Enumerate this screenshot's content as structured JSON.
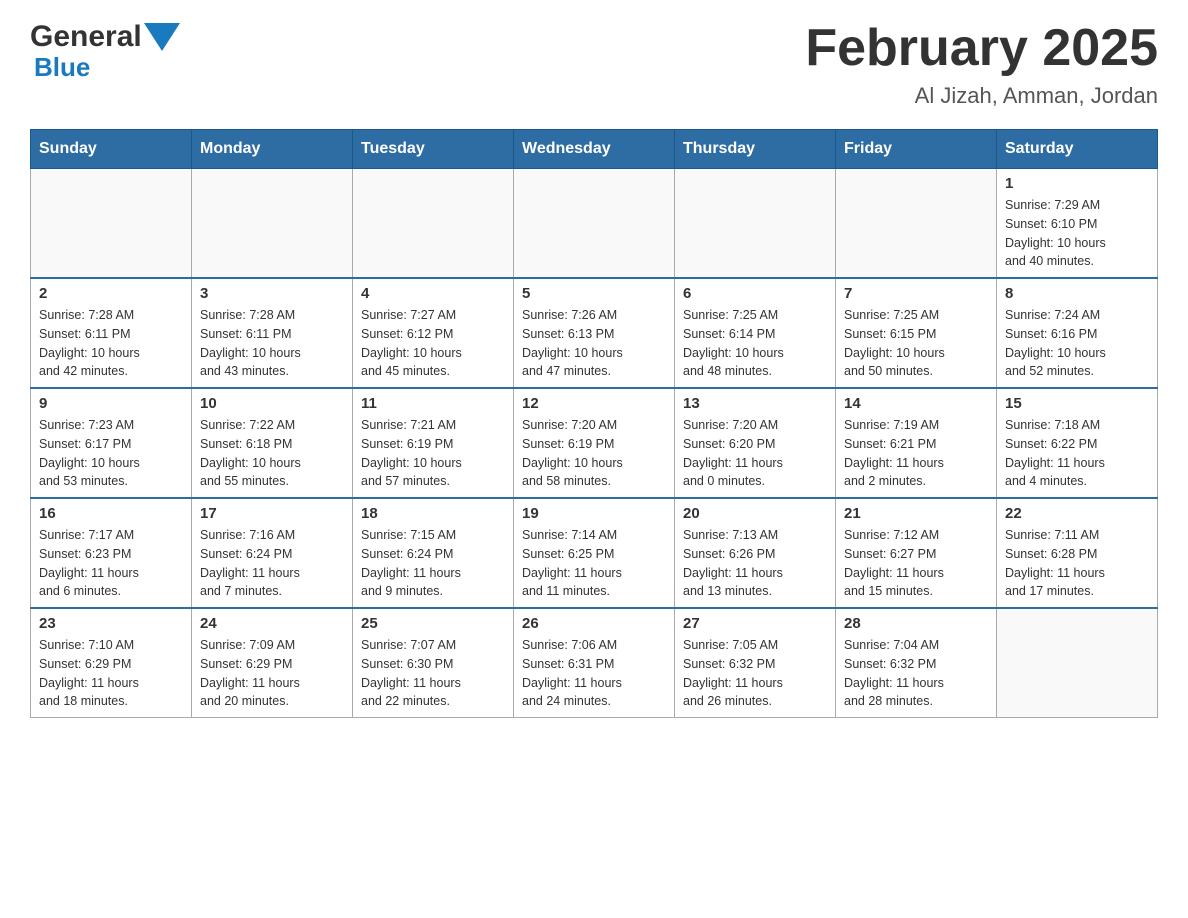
{
  "header": {
    "logo": {
      "general": "General",
      "blue": "Blue"
    },
    "title": "February 2025",
    "location": "Al Jizah, Amman, Jordan"
  },
  "days_of_week": [
    "Sunday",
    "Monday",
    "Tuesday",
    "Wednesday",
    "Thursday",
    "Friday",
    "Saturday"
  ],
  "weeks": [
    [
      {
        "day": "",
        "info": ""
      },
      {
        "day": "",
        "info": ""
      },
      {
        "day": "",
        "info": ""
      },
      {
        "day": "",
        "info": ""
      },
      {
        "day": "",
        "info": ""
      },
      {
        "day": "",
        "info": ""
      },
      {
        "day": "1",
        "info": "Sunrise: 7:29 AM\nSunset: 6:10 PM\nDaylight: 10 hours\nand 40 minutes."
      }
    ],
    [
      {
        "day": "2",
        "info": "Sunrise: 7:28 AM\nSunset: 6:11 PM\nDaylight: 10 hours\nand 42 minutes."
      },
      {
        "day": "3",
        "info": "Sunrise: 7:28 AM\nSunset: 6:11 PM\nDaylight: 10 hours\nand 43 minutes."
      },
      {
        "day": "4",
        "info": "Sunrise: 7:27 AM\nSunset: 6:12 PM\nDaylight: 10 hours\nand 45 minutes."
      },
      {
        "day": "5",
        "info": "Sunrise: 7:26 AM\nSunset: 6:13 PM\nDaylight: 10 hours\nand 47 minutes."
      },
      {
        "day": "6",
        "info": "Sunrise: 7:25 AM\nSunset: 6:14 PM\nDaylight: 10 hours\nand 48 minutes."
      },
      {
        "day": "7",
        "info": "Sunrise: 7:25 AM\nSunset: 6:15 PM\nDaylight: 10 hours\nand 50 minutes."
      },
      {
        "day": "8",
        "info": "Sunrise: 7:24 AM\nSunset: 6:16 PM\nDaylight: 10 hours\nand 52 minutes."
      }
    ],
    [
      {
        "day": "9",
        "info": "Sunrise: 7:23 AM\nSunset: 6:17 PM\nDaylight: 10 hours\nand 53 minutes."
      },
      {
        "day": "10",
        "info": "Sunrise: 7:22 AM\nSunset: 6:18 PM\nDaylight: 10 hours\nand 55 minutes."
      },
      {
        "day": "11",
        "info": "Sunrise: 7:21 AM\nSunset: 6:19 PM\nDaylight: 10 hours\nand 57 minutes."
      },
      {
        "day": "12",
        "info": "Sunrise: 7:20 AM\nSunset: 6:19 PM\nDaylight: 10 hours\nand 58 minutes."
      },
      {
        "day": "13",
        "info": "Sunrise: 7:20 AM\nSunset: 6:20 PM\nDaylight: 11 hours\nand 0 minutes."
      },
      {
        "day": "14",
        "info": "Sunrise: 7:19 AM\nSunset: 6:21 PM\nDaylight: 11 hours\nand 2 minutes."
      },
      {
        "day": "15",
        "info": "Sunrise: 7:18 AM\nSunset: 6:22 PM\nDaylight: 11 hours\nand 4 minutes."
      }
    ],
    [
      {
        "day": "16",
        "info": "Sunrise: 7:17 AM\nSunset: 6:23 PM\nDaylight: 11 hours\nand 6 minutes."
      },
      {
        "day": "17",
        "info": "Sunrise: 7:16 AM\nSunset: 6:24 PM\nDaylight: 11 hours\nand 7 minutes."
      },
      {
        "day": "18",
        "info": "Sunrise: 7:15 AM\nSunset: 6:24 PM\nDaylight: 11 hours\nand 9 minutes."
      },
      {
        "day": "19",
        "info": "Sunrise: 7:14 AM\nSunset: 6:25 PM\nDaylight: 11 hours\nand 11 minutes."
      },
      {
        "day": "20",
        "info": "Sunrise: 7:13 AM\nSunset: 6:26 PM\nDaylight: 11 hours\nand 13 minutes."
      },
      {
        "day": "21",
        "info": "Sunrise: 7:12 AM\nSunset: 6:27 PM\nDaylight: 11 hours\nand 15 minutes."
      },
      {
        "day": "22",
        "info": "Sunrise: 7:11 AM\nSunset: 6:28 PM\nDaylight: 11 hours\nand 17 minutes."
      }
    ],
    [
      {
        "day": "23",
        "info": "Sunrise: 7:10 AM\nSunset: 6:29 PM\nDaylight: 11 hours\nand 18 minutes."
      },
      {
        "day": "24",
        "info": "Sunrise: 7:09 AM\nSunset: 6:29 PM\nDaylight: 11 hours\nand 20 minutes."
      },
      {
        "day": "25",
        "info": "Sunrise: 7:07 AM\nSunset: 6:30 PM\nDaylight: 11 hours\nand 22 minutes."
      },
      {
        "day": "26",
        "info": "Sunrise: 7:06 AM\nSunset: 6:31 PM\nDaylight: 11 hours\nand 24 minutes."
      },
      {
        "day": "27",
        "info": "Sunrise: 7:05 AM\nSunset: 6:32 PM\nDaylight: 11 hours\nand 26 minutes."
      },
      {
        "day": "28",
        "info": "Sunrise: 7:04 AM\nSunset: 6:32 PM\nDaylight: 11 hours\nand 28 minutes."
      },
      {
        "day": "",
        "info": ""
      }
    ]
  ]
}
